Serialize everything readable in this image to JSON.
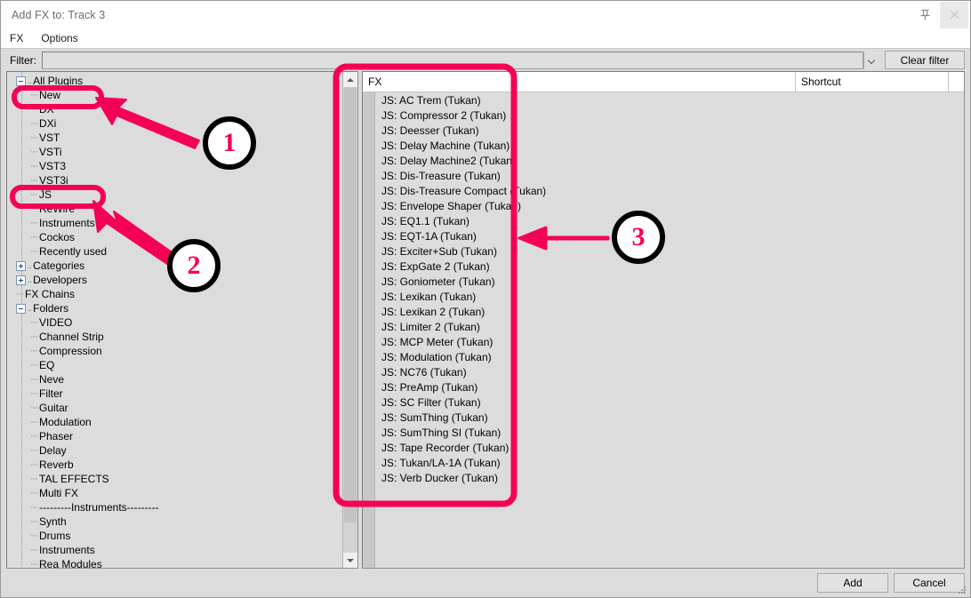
{
  "window": {
    "title": "Add FX to: Track 3",
    "pin_icon": "pin-icon",
    "close_icon": "close-icon"
  },
  "menu": {
    "items": [
      "FX",
      "Options"
    ]
  },
  "filter": {
    "label": "Filter:",
    "value": "",
    "placeholder": "",
    "dropdown_icon": "chevron-down-icon",
    "clear_label": "Clear filter"
  },
  "tree": {
    "items": [
      {
        "label": "All Plugins",
        "indent": 0,
        "expander": "minus"
      },
      {
        "label": "New",
        "indent": 1,
        "expander": "none",
        "highlight": true
      },
      {
        "label": "DX",
        "indent": 1,
        "expander": "none"
      },
      {
        "label": "DXi",
        "indent": 1,
        "expander": "none"
      },
      {
        "label": "VST",
        "indent": 1,
        "expander": "none"
      },
      {
        "label": "VSTi",
        "indent": 1,
        "expander": "none"
      },
      {
        "label": "VST3",
        "indent": 1,
        "expander": "none"
      },
      {
        "label": "VST3i",
        "indent": 1,
        "expander": "none"
      },
      {
        "label": "JS",
        "indent": 1,
        "expander": "none",
        "highlight": true
      },
      {
        "label": "ReWire",
        "indent": 1,
        "expander": "none"
      },
      {
        "label": "Instruments",
        "indent": 1,
        "expander": "none"
      },
      {
        "label": "Cockos",
        "indent": 1,
        "expander": "none"
      },
      {
        "label": "Recently used",
        "indent": 1,
        "expander": "none"
      },
      {
        "label": "Categories",
        "indent": 0,
        "expander": "plus"
      },
      {
        "label": "Developers",
        "indent": 0,
        "expander": "plus"
      },
      {
        "label": "FX Chains",
        "indent": 0,
        "expander": "none"
      },
      {
        "label": "Folders",
        "indent": 0,
        "expander": "minus"
      },
      {
        "label": "VIDEO",
        "indent": 1,
        "expander": "none"
      },
      {
        "label": "Channel Strip",
        "indent": 1,
        "expander": "none"
      },
      {
        "label": "Compression",
        "indent": 1,
        "expander": "none"
      },
      {
        "label": "EQ",
        "indent": 1,
        "expander": "none"
      },
      {
        "label": "Neve",
        "indent": 1,
        "expander": "none"
      },
      {
        "label": "Filter",
        "indent": 1,
        "expander": "none"
      },
      {
        "label": "Guitar",
        "indent": 1,
        "expander": "none"
      },
      {
        "label": "Modulation",
        "indent": 1,
        "expander": "none"
      },
      {
        "label": "Phaser",
        "indent": 1,
        "expander": "none"
      },
      {
        "label": "Delay",
        "indent": 1,
        "expander": "none"
      },
      {
        "label": "Reverb",
        "indent": 1,
        "expander": "none"
      },
      {
        "label": "TAL EFFECTS",
        "indent": 1,
        "expander": "none"
      },
      {
        "label": "Multi FX",
        "indent": 1,
        "expander": "none"
      },
      {
        "label": "---------Instruments---------",
        "indent": 1,
        "expander": "none"
      },
      {
        "label": "Synth",
        "indent": 1,
        "expander": "none"
      },
      {
        "label": "Drums",
        "indent": 1,
        "expander": "none"
      },
      {
        "label": "Instruments",
        "indent": 1,
        "expander": "none"
      },
      {
        "label": "Rea Modules",
        "indent": 1,
        "expander": "none"
      }
    ]
  },
  "list": {
    "columns": [
      "FX",
      "Shortcut",
      ""
    ],
    "items": [
      "JS: AC Trem (Tukan)",
      "JS: Compressor 2 (Tukan)",
      "JS: Deesser (Tukan)",
      "JS: Delay Machine (Tukan)",
      "JS: Delay Machine2 (Tukan)",
      "JS: Dis-Treasure (Tukan)",
      "JS: Dis-Treasure Compact (Tukan)",
      "JS: Envelope Shaper (Tukan)",
      "JS: EQ1.1 (Tukan)",
      "JS: EQT-1A (Tukan)",
      "JS: Exciter+Sub (Tukan)",
      "JS: ExpGate 2 (Tukan)",
      "JS: Goniometer (Tukan)",
      "JS: Lexikan (Tukan)",
      "JS: Lexikan 2 (Tukan)",
      "JS: Limiter 2 (Tukan)",
      "JS: MCP Meter (Tukan)",
      "JS: Modulation (Tukan)",
      "JS: NC76 (Tukan)",
      "JS: PreAmp (Tukan)",
      "JS: SC Filter (Tukan)",
      "JS: SumThing (Tukan)",
      "JS: SumThing SI (Tukan)",
      "JS: Tape Recorder (Tukan)",
      "JS: Tukan/LA-1A (Tukan)",
      "JS: Verb Ducker (Tukan)"
    ]
  },
  "footer": {
    "add_label": "Add",
    "cancel_label": "Cancel"
  },
  "annotations": {
    "accent_color": "#F50057",
    "ring_color": "#000000",
    "markers": [
      {
        "number": "1"
      },
      {
        "number": "2"
      },
      {
        "number": "3"
      }
    ]
  }
}
